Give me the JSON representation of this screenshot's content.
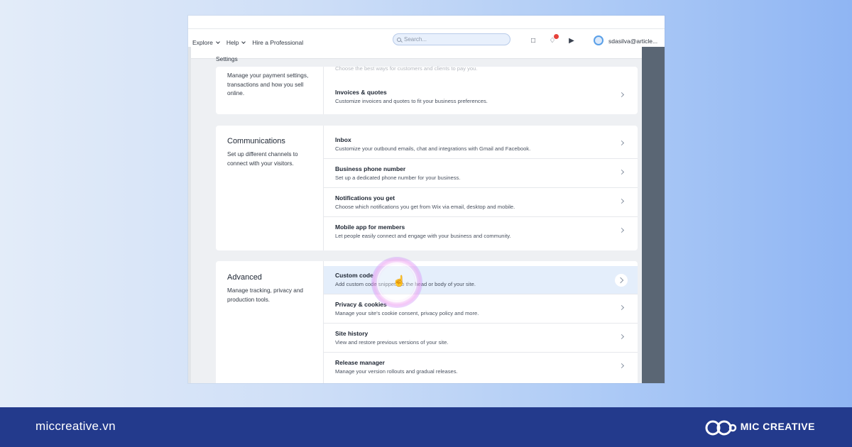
{
  "topbar": {
    "nav": [
      "Explore",
      "Help",
      "Hire a Professional"
    ],
    "search_placeholder": "Search...",
    "user": "sdasilva@article..."
  },
  "breadcrumb": "Settings",
  "payments": {
    "description": "Manage your payment settings, transactions and how you sell online.",
    "partial_row_desc": "Choose the best ways for customers and clients to pay you.",
    "rows": [
      {
        "title": "Invoices & quotes",
        "desc": "Customize invoices and quotes to fit your business preferences."
      }
    ]
  },
  "communications": {
    "title": "Communications",
    "description": "Set up different channels to connect with your visitors.",
    "rows": [
      {
        "title": "Inbox",
        "desc": "Customize your outbound emails, chat and integrations with Gmail and Facebook."
      },
      {
        "title": "Business phone number",
        "desc": "Set up a dedicated phone number for your business."
      },
      {
        "title": "Notifications you get",
        "desc": "Choose which notifications you get from Wix via email, desktop and mobile."
      },
      {
        "title": "Mobile app for members",
        "desc": "Let people easily connect and engage with your business and community."
      }
    ]
  },
  "advanced": {
    "title": "Advanced",
    "description": "Manage tracking, privacy and production tools.",
    "rows": [
      {
        "title": "Custom code",
        "desc": "Add custom code snippets to the head or body of your site."
      },
      {
        "title": "Privacy & cookies",
        "desc": "Manage your site's cookie consent, privacy policy and more."
      },
      {
        "title": "Site history",
        "desc": "View and restore previous versions of your site."
      },
      {
        "title": "Release manager",
        "desc": "Manage your version rollouts and gradual releases."
      }
    ]
  },
  "footer": {
    "site": "miccreative.vn",
    "brand": "MIC CREATIVE"
  },
  "colors": {
    "footer_bg": "#233a8c",
    "highlight_row": "#e4eefb",
    "notification_badge": "#e6423a"
  }
}
